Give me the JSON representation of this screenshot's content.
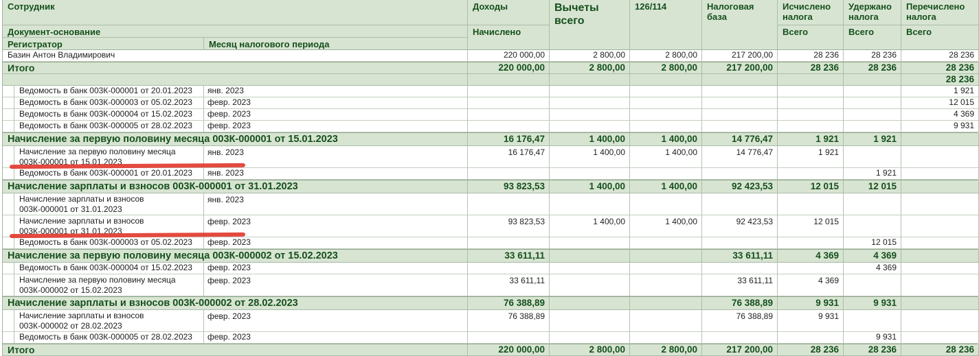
{
  "colors": {
    "header_bg": "#d8e4d2",
    "dark_green_text": "#14501c",
    "grid_line": "#a9bca6",
    "red_marker": "#e23b2f",
    "row_bg": "#ffffff"
  },
  "table": {
    "header": {
      "employee": "Сотрудник",
      "document": "Документ-основание",
      "registrar": "Регистратор",
      "month": "Месяц налогового периода",
      "columns": [
        {
          "id": "income",
          "label": "Доходы",
          "sub": "Начислено"
        },
        {
          "id": "deductions",
          "label": "Вычеты всего",
          "sub": ""
        },
        {
          "id": "code",
          "label": "126/114",
          "sub": ""
        },
        {
          "id": "tax-base",
          "label": "Налоговая база",
          "sub": ""
        },
        {
          "id": "calculated",
          "label": "Исчислено налога",
          "sub": "Всего"
        },
        {
          "id": "withheld",
          "label": "Удержано налога",
          "sub": "Всего"
        },
        {
          "id": "transferred",
          "label": "Перечислено налога",
          "sub": "Всего"
        }
      ]
    },
    "rows": [
      {
        "type": "employee",
        "label": "Базин Антон Владимирович",
        "values": [
          "220 000,00",
          "2 800,00",
          "2 800,00",
          "217 200,00",
          "28 236",
          "28 236",
          "28 236"
        ]
      },
      {
        "type": "total",
        "label": "Итого",
        "values": [
          "220 000,00",
          "2 800,00",
          "2 800,00",
          "217 200,00",
          "28 236",
          "28 236",
          "28 236"
        ]
      },
      {
        "type": "spacer",
        "label": "",
        "values": [
          "",
          "",
          "",
          "",
          "",
          "",
          "28 236"
        ]
      },
      {
        "type": "detail",
        "registrar": "Ведомость в банк 003К-000001 от 20.01.2023",
        "month": "янв. 2023",
        "values": [
          "",
          "",
          "",
          "",
          "",
          "",
          "1 921"
        ]
      },
      {
        "type": "detail",
        "registrar": "Ведомость в банк 003К-000003 от 05.02.2023",
        "month": "февр. 2023",
        "values": [
          "",
          "",
          "",
          "",
          "",
          "",
          "12 015"
        ]
      },
      {
        "type": "detail",
        "registrar": "Ведомость в банк 003К-000004 от 15.02.2023",
        "month": "февр. 2023",
        "values": [
          "",
          "",
          "",
          "",
          "",
          "",
          "4 369"
        ]
      },
      {
        "type": "detail",
        "registrar": "Ведомость в банк 003К-000005 от 28.02.2023",
        "month": "февр. 2023",
        "values": [
          "",
          "",
          "",
          "",
          "",
          "",
          "9 931"
        ]
      },
      {
        "type": "section",
        "label": "Начисление за первую половину месяца 003К-000001 от 15.01.2023",
        "values": [
          "16 176,47",
          "1 400,00",
          "1 400,00",
          "14 776,47",
          "1 921",
          "1 921",
          ""
        ]
      },
      {
        "type": "detail2",
        "line1": "Начисление за первую половину месяца",
        "line2": "003К-000001 от 15.01.2023",
        "month": "янв. 2023",
        "values": [
          "16 176,47",
          "1 400,00",
          "1 400,00",
          "14 776,47",
          "1 921",
          "",
          ""
        ]
      },
      {
        "type": "detail",
        "registrar": "Ведомость в банк 003К-000001 от 20.01.2023",
        "month": "янв. 2023",
        "values": [
          "",
          "",
          "",
          "",
          "",
          "1 921",
          ""
        ]
      },
      {
        "type": "section",
        "label": "Начисление зарплаты и взносов 003К-000001 от 31.01.2023",
        "values": [
          "93 823,53",
          "1 400,00",
          "1 400,00",
          "92 423,53",
          "12 015",
          "12 015",
          ""
        ]
      },
      {
        "type": "detail2",
        "line1": "Начисление зарплаты и взносов",
        "line2": "003К-000001 от 31.01.2023",
        "month": "янв. 2023",
        "values": [
          "",
          "",
          "",
          "",
          "",
          "",
          ""
        ]
      },
      {
        "type": "detail2",
        "line1": "Начисление зарплаты и взносов",
        "line2": "003К-000001 от 31.01.2023",
        "month": "февр. 2023",
        "values": [
          "93 823,53",
          "1 400,00",
          "1 400,00",
          "92 423,53",
          "12 015",
          "",
          ""
        ]
      },
      {
        "type": "detail",
        "registrar": "Ведомость в банк 003К-000003 от 05.02.2023",
        "month": "февр. 2023",
        "values": [
          "",
          "",
          "",
          "",
          "",
          "12 015",
          ""
        ]
      },
      {
        "type": "section",
        "label": "Начисление за первую половину месяца 003К-000002 от 15.02.2023",
        "values": [
          "33 611,11",
          "",
          "",
          "33 611,11",
          "4 369",
          "4 369",
          ""
        ]
      },
      {
        "type": "detail",
        "registrar": "Ведомость в банк 003К-000004 от 15.02.2023",
        "month": "февр. 2023",
        "values": [
          "",
          "",
          "",
          "",
          "",
          "4 369",
          ""
        ]
      },
      {
        "type": "detail2",
        "line1": "Начисление за первую половину месяца",
        "line2": "003К-000002 от 15.02.2023",
        "month": "февр. 2023",
        "values": [
          "33 611,11",
          "",
          "",
          "33 611,11",
          "4 369",
          "",
          ""
        ]
      },
      {
        "type": "section",
        "label": "Начисление зарплаты и взносов 003К-000002 от 28.02.2023",
        "values": [
          "76 388,89",
          "",
          "",
          "76 388,89",
          "9 931",
          "9 931",
          ""
        ]
      },
      {
        "type": "detail2",
        "line1": "Начисление зарплаты и взносов",
        "line2": "003К-000002 от 28.02.2023",
        "month": "февр. 2023",
        "values": [
          "76 388,89",
          "",
          "",
          "76 388,89",
          "9 931",
          "",
          ""
        ]
      },
      {
        "type": "detail",
        "registrar": "Ведомость в банк 003К-000005 от 28.02.2023",
        "month": "февр. 2023",
        "values": [
          "",
          "",
          "",
          "",
          "",
          "9 931",
          ""
        ]
      },
      {
        "type": "total",
        "label": "Итого",
        "values": [
          "220 000,00",
          "2 800,00",
          "2 800,00",
          "217 200,00",
          "28 236",
          "28 236",
          "28 236"
        ]
      }
    ],
    "annotations": [
      {
        "id": "red-line-1",
        "type": "red-marker-underline",
        "underlines": "003К-000001 от 15.01.2023"
      },
      {
        "id": "red-line-2",
        "type": "red-marker-underline",
        "underlines": "003К-000001 от 31.01.2023"
      }
    ]
  }
}
